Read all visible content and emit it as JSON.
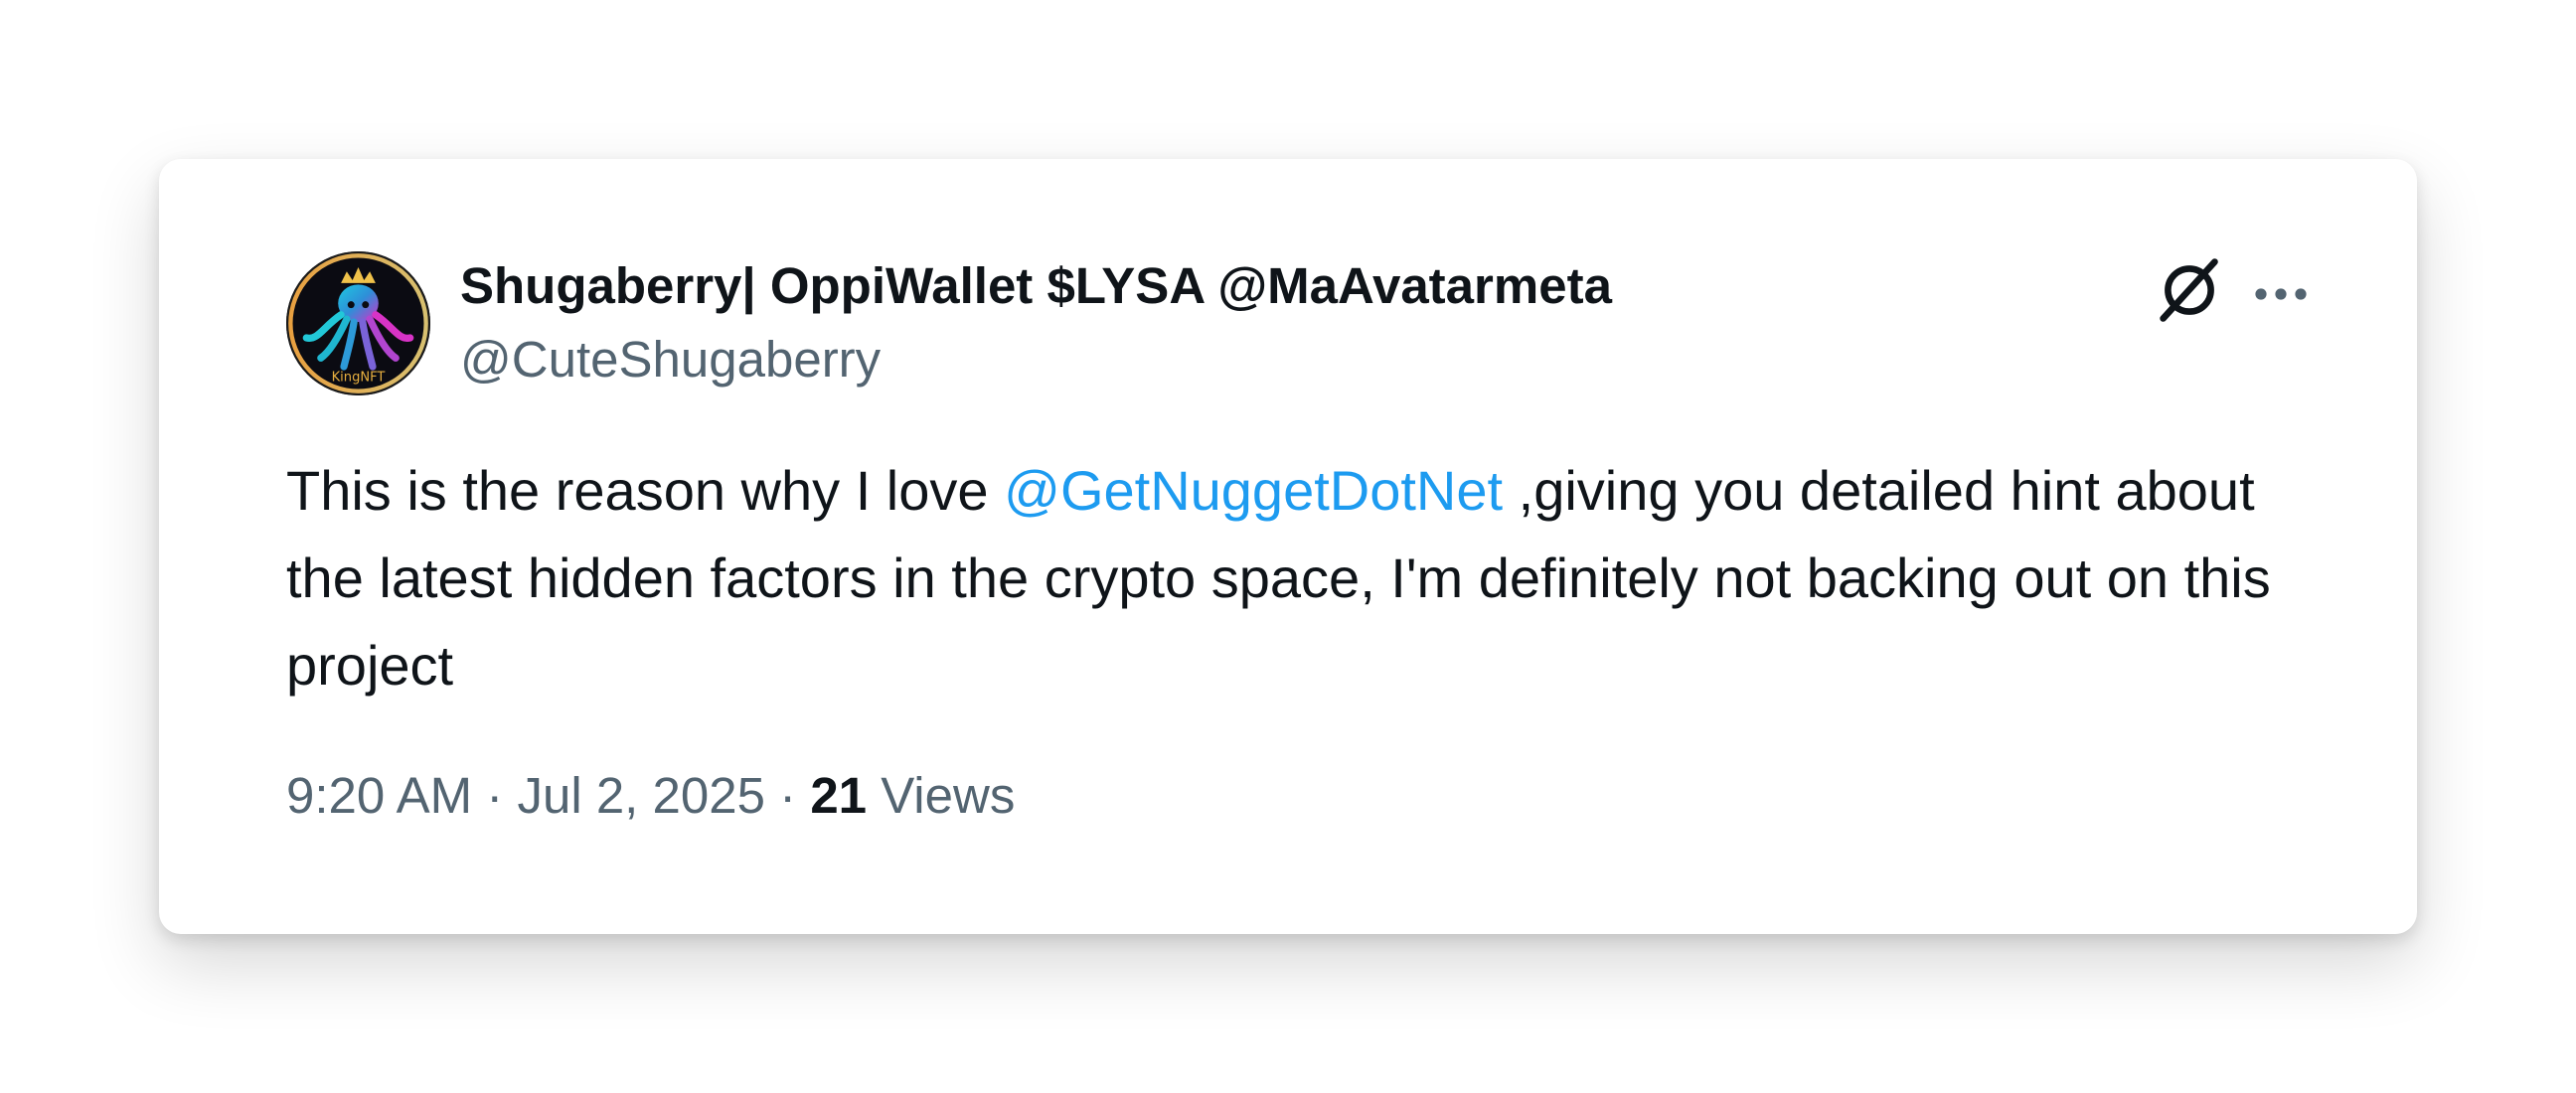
{
  "author": {
    "display_name": "Shugaberry| OppiWallet $LYSA @MaAvatarmeta",
    "handle": "@CuteShugaberry",
    "avatar_text": "KingNFT"
  },
  "actions": {
    "grok_icon": "grok-icon",
    "more_icon": "more-icon"
  },
  "tweet": {
    "text_before": "This is the reason why I love ",
    "mention": "@GetNuggetDotNet",
    "text_after": " ,giving you detailed hint about the latest hidden factors in the crypto space, I'm definitely not backing out on this project"
  },
  "meta": {
    "time": "9:20 AM",
    "sep1": " · ",
    "date": "Jul 2, 2025",
    "sep2": " · ",
    "views_count": "21",
    "views_label": " Views"
  },
  "colors": {
    "text": "#0f1419",
    "secondary": "#536471",
    "link": "#1d9bf0"
  }
}
